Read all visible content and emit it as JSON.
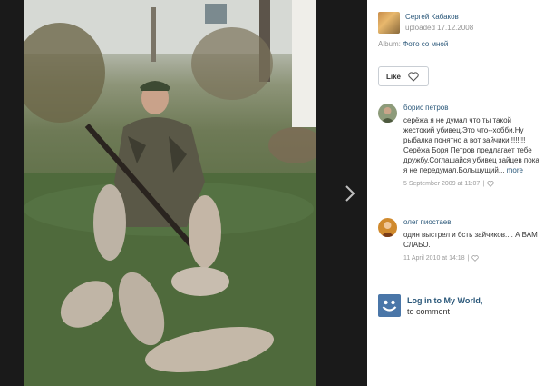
{
  "uploader": {
    "name": "Сергей Кабаков",
    "uploaded": "uploaded 17.12.2008"
  },
  "album": {
    "prefix": "Album:",
    "name": "Фото со мной"
  },
  "like": {
    "label": "Like"
  },
  "comments": [
    {
      "author": "борис петров",
      "text": "серёжа я не думал что ты такой жестокий убивец.Это что--хобби.Ну рыбалка понятно а вот зайчики!!!!!!!! Серёжа Боря Петров предлагает тебе дружбу.Соглашайся убивец зайцев пока я не передумал.Большущий...",
      "more": "more",
      "date": "5 September 2009 at 11:07",
      "sep": "|"
    },
    {
      "author": "олег пиостаев",
      "text": "один выстрел и бсть зайчиков.... А ВАМ СЛАБО.",
      "date": "11 April 2010 at 14:18",
      "sep": "|"
    }
  ],
  "login": {
    "link": "Log in to My World,",
    "sub": "to comment"
  },
  "colors": {
    "link": "#2b587a",
    "viewer_bg": "#1a1a1a",
    "panel_bg": "#ffffff",
    "login_icon": "#4a76a8"
  },
  "icons": {
    "next": "chevron-right-icon",
    "like": "heart-icon",
    "login": "myworld-smile-icon"
  }
}
